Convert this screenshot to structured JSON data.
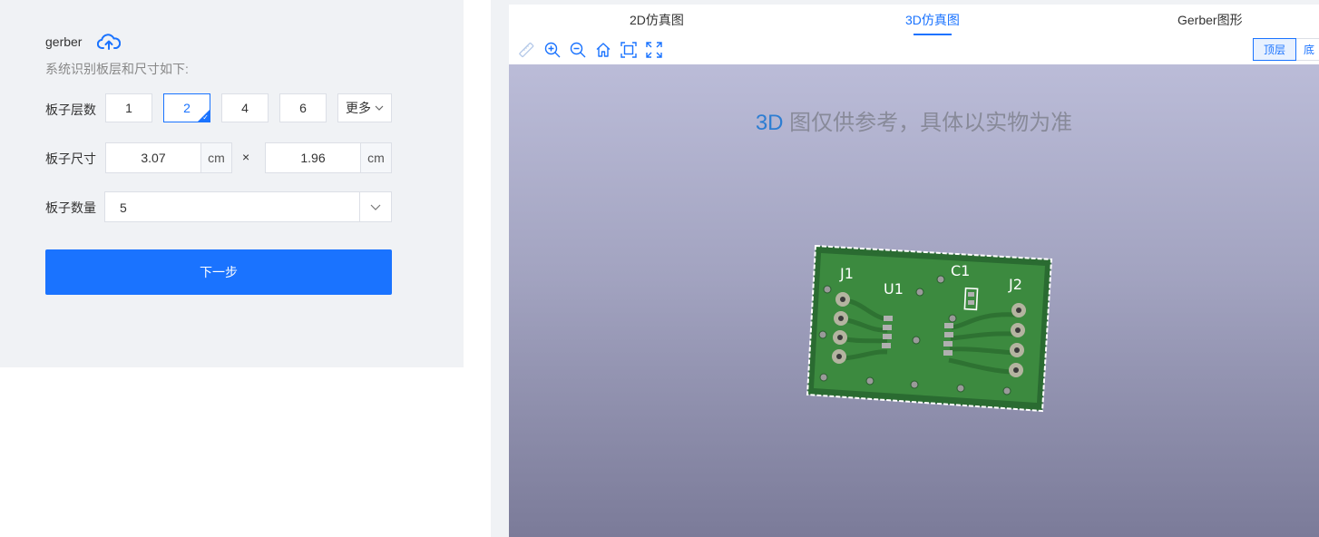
{
  "left": {
    "file_label": "gerber",
    "upload_icon": "cloud-upload-icon",
    "hint": "系统识别板层和尺寸如下:",
    "layers": {
      "label": "板子层数",
      "options": [
        "1",
        "2",
        "4",
        "6"
      ],
      "selected": "2",
      "more_label": "更多"
    },
    "size": {
      "label": "板子尺寸",
      "width": "3.07",
      "height": "1.96",
      "unit": "cm",
      "times": "×"
    },
    "quantity": {
      "label": "板子数量",
      "value": "5"
    },
    "next_button": "下一步",
    "accent_color": "#1a73ff"
  },
  "viewer": {
    "tabs": [
      "2D仿真图",
      "3D仿真图",
      "Gerber图形"
    ],
    "active_tab": "3D仿真图",
    "toolbar_icons": [
      "ruler-icon",
      "zoom-in-icon",
      "zoom-out-icon",
      "home-icon",
      "fit-screen-icon",
      "fullscreen-icon"
    ],
    "layer_buttons": {
      "top": "顶层",
      "bottom": "底"
    },
    "disclaimer_accent": "3D",
    "disclaimer_text": " 图仅供参考，具体以实物为准",
    "pcb_labels": [
      "J1",
      "U1",
      "C1",
      "J2"
    ],
    "pcb_color": "#2e7d32"
  }
}
